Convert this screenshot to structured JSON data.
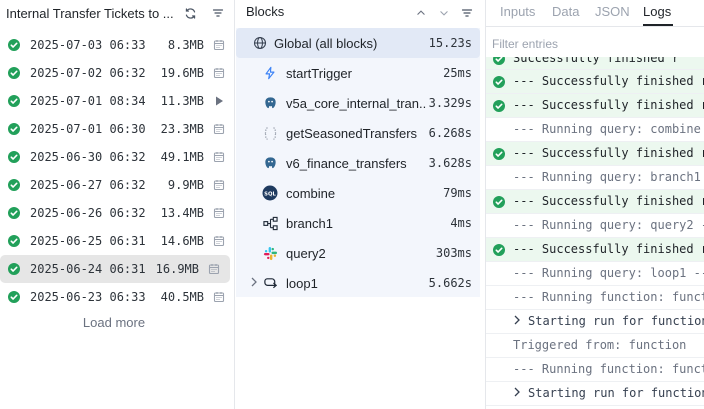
{
  "runs": {
    "title": "Internal Transfer Tickets to ...",
    "header_icons": [
      "refresh-icon",
      "filter-icon"
    ],
    "items": [
      {
        "date": "2025-07-03 06:33",
        "size": "8.3MB",
        "status": "success",
        "action": "calendar-icon"
      },
      {
        "date": "2025-07-02 06:32",
        "size": "19.6MB",
        "status": "success",
        "action": "calendar-icon"
      },
      {
        "date": "2025-07-01 08:34",
        "size": "11.3MB",
        "status": "success",
        "action": "play-icon"
      },
      {
        "date": "2025-07-01 06:30",
        "size": "23.3MB",
        "status": "success",
        "action": "calendar-icon"
      },
      {
        "date": "2025-06-30 06:32",
        "size": "49.1MB",
        "status": "success",
        "action": "calendar-icon"
      },
      {
        "date": "2025-06-27 06:32",
        "size": "9.9MB",
        "status": "success",
        "action": "calendar-icon"
      },
      {
        "date": "2025-06-26 06:32",
        "size": "13.4MB",
        "status": "success",
        "action": "calendar-icon"
      },
      {
        "date": "2025-06-25 06:31",
        "size": "14.6MB",
        "status": "success",
        "action": "calendar-icon"
      },
      {
        "date": "2025-06-24 06:31",
        "size": "16.9MB",
        "status": "success",
        "action": "calendar-icon",
        "selected": true
      },
      {
        "date": "2025-06-23 06:33",
        "size": "40.5MB",
        "status": "success",
        "action": "calendar-icon"
      }
    ],
    "load_more": "Load more"
  },
  "blocks": {
    "title": "Blocks",
    "items": [
      {
        "name": "Global (all blocks)",
        "time": "15.23s",
        "icon": "globe-icon",
        "selected": true
      },
      {
        "name": "startTrigger",
        "time": "25ms",
        "icon": "lightning-icon"
      },
      {
        "name": "v5a_core_internal_tran...",
        "time": "3.329s",
        "icon": "postgres-icon"
      },
      {
        "name": "getSeasonedTransfers",
        "time": "6.268s",
        "icon": "code-braces-icon"
      },
      {
        "name": "v6_finance_transfers",
        "time": "3.628s",
        "icon": "postgres-icon"
      },
      {
        "name": "combine",
        "time": "79ms",
        "icon": "sql-icon"
      },
      {
        "name": "branch1",
        "time": "4ms",
        "icon": "branch-icon"
      },
      {
        "name": "query2",
        "time": "303ms",
        "icon": "slack-icon"
      },
      {
        "name": "loop1",
        "time": "5.662s",
        "icon": "loop-icon",
        "expandable": true
      }
    ]
  },
  "logs": {
    "tabs": [
      "Inputs",
      "Data",
      "JSON",
      "Logs"
    ],
    "active_tab": "Logs",
    "filter_placeholder": "Filter entries",
    "lines": [
      {
        "text": "  Successfully finished r",
        "kind": "success"
      },
      {
        "text": "--- Successfully finished r",
        "kind": "success"
      },
      {
        "text": "--- Successfully finished r",
        "kind": "success"
      },
      {
        "text": "--- Running query: combine",
        "kind": "plain"
      },
      {
        "text": "--- Successfully finished r",
        "kind": "success"
      },
      {
        "text": "--- Running query: branch1",
        "kind": "plain"
      },
      {
        "text": "--- Successfully finished r",
        "kind": "success"
      },
      {
        "text": "--- Running query: query2 -",
        "kind": "plain"
      },
      {
        "text": "--- Successfully finished r",
        "kind": "success"
      },
      {
        "text": "--- Running query: loop1 --",
        "kind": "plain"
      },
      {
        "text": "--- Running function: funct",
        "kind": "plain"
      },
      {
        "text": "Starting run for function",
        "kind": "expandable"
      },
      {
        "text": "Triggered from: function",
        "kind": "trigger"
      },
      {
        "text": "--- Running function: funct",
        "kind": "plain"
      },
      {
        "text": "Starting run for function",
        "kind": "expandable"
      }
    ]
  },
  "colors": {
    "success_green": "#22a05a",
    "selected_block_bg": "#e2e9f6",
    "blocks_bg": "#f3f6fc",
    "log_success_bg": "#ecf8ef"
  }
}
